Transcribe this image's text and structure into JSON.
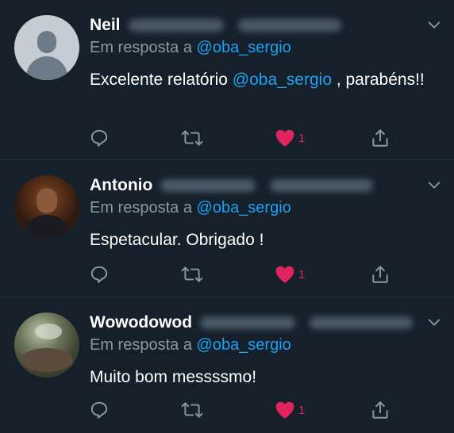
{
  "colors": {
    "background": "#15202b",
    "divider": "#253341",
    "secondary_text": "#8899a6",
    "mention": "#1da1f2",
    "like": "#e0245e"
  },
  "tweets": [
    {
      "author_name": "Neil",
      "avatar": "default-avatar",
      "reply_prefix": "Em resposta a",
      "reply_to": "@oba_sergio",
      "text_before": "Excelente relatório ",
      "text_mention": "@oba_sergio",
      "text_after": " , parabéns!!",
      "like_count": "1"
    },
    {
      "author_name": "Antonio",
      "avatar": "photo-avatar",
      "reply_prefix": "Em resposta a",
      "reply_to": "@oba_sergio",
      "text": "Espetacular. Obrigado !",
      "like_count": "1"
    },
    {
      "author_name": "Wowodowod",
      "avatar": "photo-avatar",
      "reply_prefix": "Em resposta a",
      "reply_to": "@oba_sergio",
      "text": "Muito bom messssmo!",
      "like_count": "1"
    }
  ],
  "icons": {
    "reply": "reply-icon",
    "retweet": "retweet-icon",
    "like": "heart-icon",
    "share": "share-icon",
    "menu": "chevron-down-icon"
  }
}
